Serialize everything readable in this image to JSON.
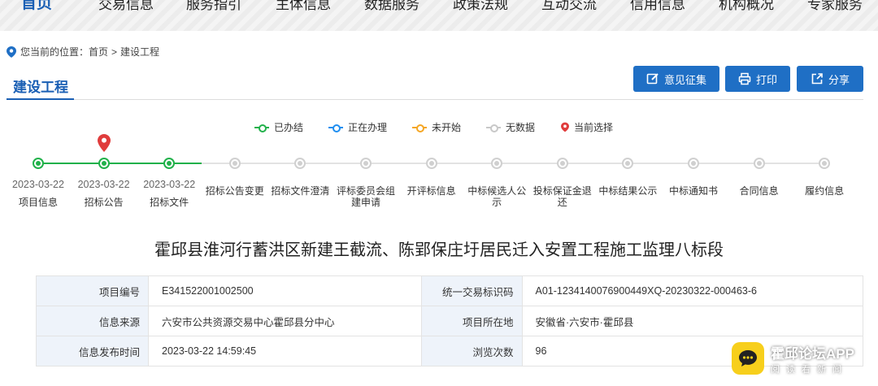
{
  "nav": {
    "items": [
      "首页",
      "交易信息",
      "服务指引",
      "主体信息",
      "数据服务",
      "政策法规",
      "互动交流",
      "信用信息",
      "机构概况",
      "专家服务"
    ]
  },
  "breadcrumb": {
    "prefix": "您当前的位置：",
    "home": "首页",
    "sep": ">",
    "current": "建设工程"
  },
  "section": {
    "title": "建设工程"
  },
  "buttons": {
    "feedback": "意见征集",
    "print": "打印",
    "share": "分享"
  },
  "legend": {
    "done": "已办结",
    "in_progress": "正在办理",
    "not_started": "未开始",
    "no_data": "无数据",
    "current": "当前选择"
  },
  "colors": {
    "done": "#21b14a",
    "in_progress": "#1f8ef0",
    "not_started": "#f5a623",
    "no_data": "#c8c8c8",
    "current": "#e03c3c",
    "accent": "#1f6fc5"
  },
  "timeline": {
    "steps": [
      {
        "date": "2023-03-22",
        "label": "项目信息",
        "status": "done"
      },
      {
        "date": "2023-03-22",
        "label": "招标公告",
        "status": "done",
        "current": true
      },
      {
        "date": "2023-03-22",
        "label": "招标文件",
        "status": "done"
      },
      {
        "date": "",
        "label": "招标公告变更",
        "status": "nodata"
      },
      {
        "date": "",
        "label": "招标文件澄清",
        "status": "nodata"
      },
      {
        "date": "",
        "label": "评标委员会组建申请",
        "status": "nodata"
      },
      {
        "date": "",
        "label": "开评标信息",
        "status": "nodata"
      },
      {
        "date": "",
        "label": "中标候选人公示",
        "status": "nodata"
      },
      {
        "date": "",
        "label": "投标保证金退还",
        "status": "nodata"
      },
      {
        "date": "",
        "label": "中标结果公示",
        "status": "nodata"
      },
      {
        "date": "",
        "label": "中标通知书",
        "status": "nodata"
      },
      {
        "date": "",
        "label": "合同信息",
        "status": "nodata"
      },
      {
        "date": "",
        "label": "履约信息",
        "status": "nodata"
      }
    ]
  },
  "headline": "霍邱县淮河行蓄洪区新建王截流、陈郢保庄圩居民迁入安置工程施工监理八标段",
  "info": {
    "rows": [
      {
        "k1": "项目编号",
        "v1": "E341522001002500",
        "k2": "统一交易标识码",
        "v2": "A01-1234140076900449XQ-20230322-000463-6"
      },
      {
        "k1": "信息来源",
        "v1": "六安市公共资源交易中心霍邱县分中心",
        "k2": "项目所在地",
        "v2": "安徽省·六安市·霍邱县"
      },
      {
        "k1": "信息发布时间",
        "v1": "2023-03-22 14:59:45",
        "k2": "浏览次数",
        "v2": "96"
      }
    ]
  },
  "watermark": {
    "title": "霍邱论坛APP",
    "subtitle": "阅读看新闻"
  }
}
